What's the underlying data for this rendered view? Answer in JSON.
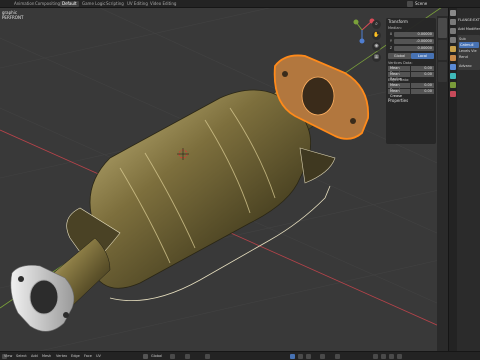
{
  "top_tabs": [
    {
      "label": "Animation",
      "active": false
    },
    {
      "label": "Compositing",
      "active": false
    },
    {
      "label": "Default",
      "active": true
    },
    {
      "label": "Game Logic",
      "active": false
    },
    {
      "label": "Scripting",
      "active": false
    },
    {
      "label": "UV Editing",
      "active": false
    },
    {
      "label": "Video Editing",
      "active": false
    }
  ],
  "top_right": {
    "scene_label": "Scene"
  },
  "viewport": {
    "overlay_line1": "graphic",
    "overlay_line2": "PERFRONT"
  },
  "npanel": {
    "transform_title": "Transform",
    "median_label": "Median:",
    "x_label": "X",
    "x_value": "0.00000",
    "y_label": "Y",
    "y_value": "-0.00000",
    "z_label": "Z",
    "z_value": "0.00000",
    "global_label": "Global",
    "local_label": "Local",
    "vertices_data_label": "Vertices Data:",
    "mean_bevel_label": "Mean Bevel",
    "mean_bevel_value": "0.00",
    "mean_radius_label": "Mean Radius",
    "mean_radius_value": "0.00",
    "edges_data_label": "Edges Data:",
    "edge_bevel_label": "Mean Bevel",
    "edge_bevel_value": "0.00",
    "mean_crease_label": "Mean Crease",
    "mean_crease_value": "0.00",
    "properties_label": "Properties"
  },
  "properties_editor": {
    "object_name": "FLANGE:EXT",
    "add_modifier": "Add Modifier",
    "modifier_short": "Sub",
    "catmull": "Catmull",
    "levels": "Levels Vie",
    "render": "Rend",
    "advanced": "Advanc"
  },
  "bottom_menu": [
    "View",
    "Select",
    "Add",
    "Mesh",
    "Vertex",
    "Edge",
    "Face",
    "UV"
  ],
  "bottom_mode": "Global",
  "colors": {
    "accent": "#4772b3",
    "selection_orange": "#ff8a1a",
    "axis_red": "#b8434a",
    "axis_green": "#7ba23a"
  }
}
